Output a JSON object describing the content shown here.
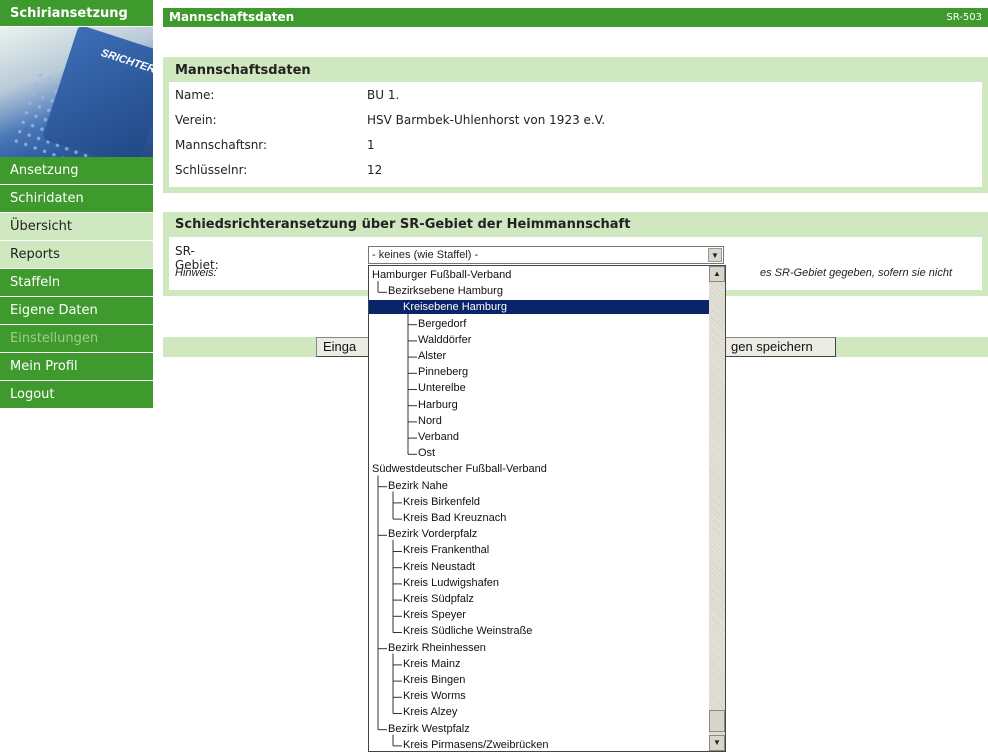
{
  "sidebar": {
    "brand": "Schiriansetzung",
    "banner_text": "SRICHTER",
    "items": [
      {
        "label": "Ansetzung",
        "state": "normal"
      },
      {
        "label": "Schiridaten",
        "state": "normal"
      },
      {
        "label": "Übersicht",
        "state": "active"
      },
      {
        "label": "Reports",
        "state": "active"
      },
      {
        "label": "Staffeln",
        "state": "normal"
      },
      {
        "label": "Eigene Daten",
        "state": "normal"
      },
      {
        "label": "Einstellungen",
        "state": "disabled"
      },
      {
        "label": "Mein Profil",
        "state": "normal"
      },
      {
        "label": "Logout",
        "state": "normal"
      }
    ]
  },
  "header": {
    "title": "Mannschaftsdaten",
    "code": "SR-503"
  },
  "team": {
    "title": "Mannschaftsdaten",
    "fields": [
      {
        "label": "Name:",
        "value": "BU 1."
      },
      {
        "label": "Verein:",
        "value": "HSV Barmbek-Uhlenhorst von 1923 e.V."
      },
      {
        "label": "Mannschaftsnr:",
        "value": "1"
      },
      {
        "label": "Schlüsselnr:",
        "value": "12"
      }
    ]
  },
  "assignment": {
    "title": "Schiedsrichteransetzung über SR-Gebiet der Heimmannschaft",
    "area_label": "SR-Gebiet:",
    "hint_label": "Hinweis:",
    "hint_text_visible": "es SR-Gebiet gegeben, sofern sie nicht",
    "selected": "- keines (wie Staffel) -"
  },
  "buttons": {
    "left_fragment": "Einga",
    "right_fragment": "gen speichern"
  },
  "dropdown": {
    "options": [
      {
        "label": "Hamburger Fußball-Verband",
        "level": 0,
        "selected": false
      },
      {
        "label": "Bezirksebene Hamburg",
        "level": 1,
        "selected": false
      },
      {
        "label": "Kreisebene Hamburg",
        "level": 2,
        "selected": true
      },
      {
        "label": "Bergedorf",
        "level": 3,
        "selected": false
      },
      {
        "label": "Walddörfer",
        "level": 3,
        "selected": false
      },
      {
        "label": "Alster",
        "level": 3,
        "selected": false
      },
      {
        "label": "Pinneberg",
        "level": 3,
        "selected": false
      },
      {
        "label": "Unterelbe",
        "level": 3,
        "selected": false
      },
      {
        "label": "Harburg",
        "level": 3,
        "selected": false
      },
      {
        "label": "Nord",
        "level": 3,
        "selected": false
      },
      {
        "label": "Verband",
        "level": 3,
        "selected": false
      },
      {
        "label": "Ost",
        "level": 3,
        "selected": false
      },
      {
        "label": "Südwestdeutscher Fußball-Verband",
        "level": 0,
        "selected": false
      },
      {
        "label": "Bezirk Nahe",
        "level": 1,
        "selected": false
      },
      {
        "label": "Kreis Birkenfeld",
        "level": 2,
        "selected": false
      },
      {
        "label": "Kreis Bad Kreuznach",
        "level": 2,
        "selected": false
      },
      {
        "label": "Bezirk Vorderpfalz",
        "level": 1,
        "selected": false
      },
      {
        "label": "Kreis Frankenthal",
        "level": 2,
        "selected": false
      },
      {
        "label": "Kreis Neustadt",
        "level": 2,
        "selected": false
      },
      {
        "label": "Kreis Ludwigshafen",
        "level": 2,
        "selected": false
      },
      {
        "label": "Kreis Südpfalz",
        "level": 2,
        "selected": false
      },
      {
        "label": "Kreis Speyer",
        "level": 2,
        "selected": false
      },
      {
        "label": "Kreis Südliche Weinstraße",
        "level": 2,
        "selected": false
      },
      {
        "label": "Bezirk Rheinhessen",
        "level": 1,
        "selected": false
      },
      {
        "label": "Kreis Mainz",
        "level": 2,
        "selected": false
      },
      {
        "label": "Kreis Bingen",
        "level": 2,
        "selected": false
      },
      {
        "label": "Kreis Worms",
        "level": 2,
        "selected": false
      },
      {
        "label": "Kreis Alzey",
        "level": 2,
        "selected": false
      },
      {
        "label": "Bezirk Westpfalz",
        "level": 1,
        "selected": false
      },
      {
        "label": "Kreis Pirmasens/Zweibrücken",
        "level": 2,
        "selected": false
      }
    ]
  }
}
